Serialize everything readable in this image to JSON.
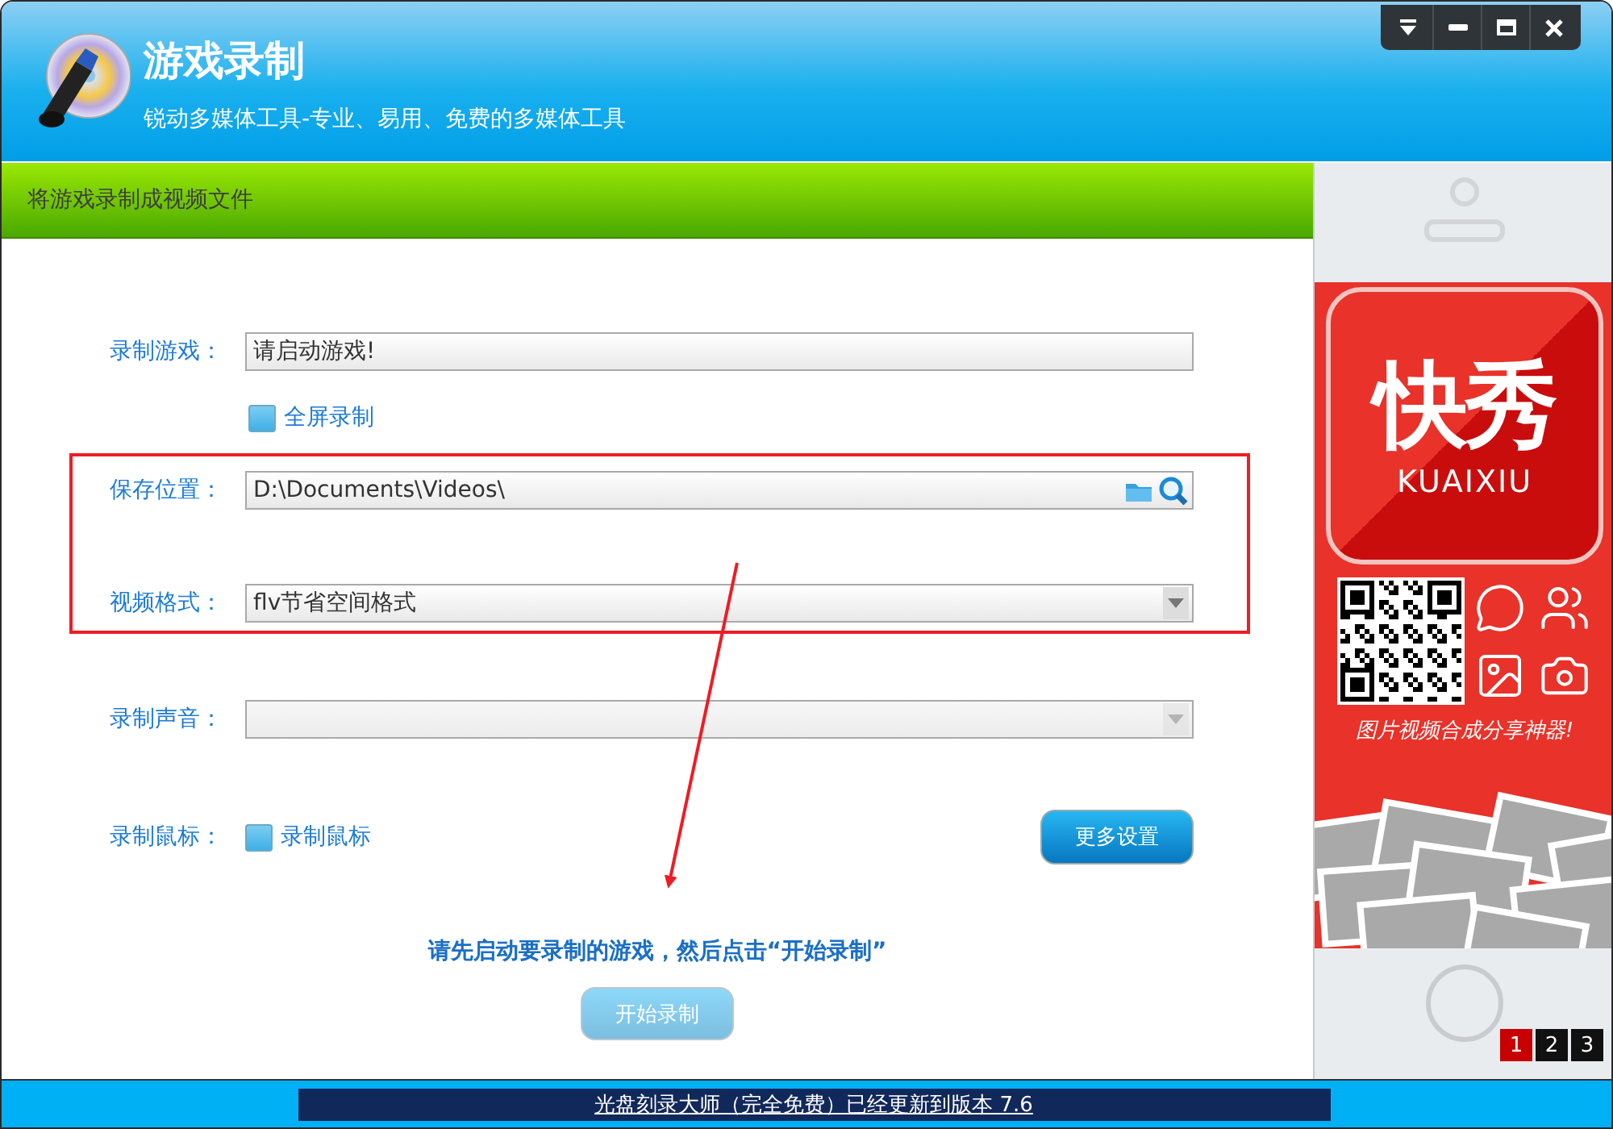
{
  "app": {
    "title": "游戏录制",
    "subtitle": "锐动多媒体工具-专业、易用、免费的多媒体工具"
  },
  "window_controls": [
    {
      "kind": "menu"
    },
    {
      "kind": "minimize"
    },
    {
      "kind": "maximize"
    },
    {
      "kind": "close"
    }
  ],
  "section_bar": {
    "title": "将游戏录制成视频文件"
  },
  "form": {
    "rows": [
      {
        "kind": "text",
        "label": "录制游戏：",
        "value": "请启动游戏!",
        "highlight": false
      },
      {
        "kind": "checkbox",
        "text": "全屏录制",
        "checked": false,
        "highlight": false
      },
      {
        "kind": "path",
        "label": "保存位置：",
        "value": "D:\\Documents\\Videos\\",
        "highlight": true
      },
      {
        "kind": "select",
        "label": "视频格式：",
        "value": "flv节省空间格式",
        "disabled": false,
        "highlight": true
      },
      {
        "kind": "select",
        "label": "录制声音：",
        "disabled": true,
        "highlight": false
      },
      {
        "kind": "checkbox",
        "label": "录制鼠标：",
        "text": "录制鼠标",
        "checked": false,
        "button": "更多设置",
        "highlight": false
      }
    ]
  },
  "hint": "请先启动要录制的游戏，然后点击“开始录制”",
  "start_button": {
    "label": "开始录制",
    "disabled": true
  },
  "ad": {
    "brand": "快秀",
    "brand_latin": "KUAIXIU",
    "slogan": "图片视频合成分享神器!",
    "pages": [
      {
        "label": "1",
        "selected": true
      },
      {
        "label": "2",
        "selected": false
      },
      {
        "label": "3",
        "selected": false
      }
    ]
  },
  "status_bar": {
    "text": "光盘刻录大师（完全免费）已经更新到版本 7.6"
  }
}
